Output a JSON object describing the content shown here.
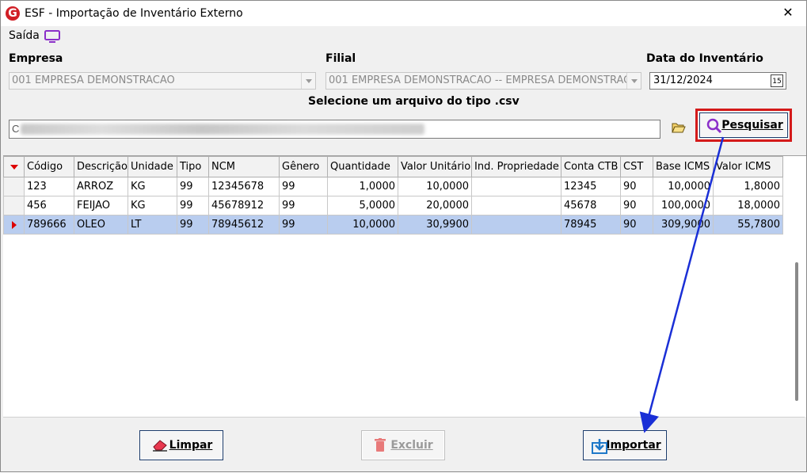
{
  "window": {
    "title": "ESF - Importação de Inventário Externo",
    "app_icon_letter": "G",
    "close_glyph": "✕"
  },
  "saida": {
    "label": "Saída",
    "icon": "monitor-icon"
  },
  "empresa": {
    "label": "Empresa",
    "value": "001 EMPRESA DEMONSTRACAO"
  },
  "filial": {
    "label": "Filial",
    "value": "001 EMPRESA DEMONSTRACAO -- EMPRESA DEMONSTRACAO"
  },
  "data_inventario": {
    "label": "Data do Inventário",
    "value": "31/12/2024",
    "calendar_icon_text": "15"
  },
  "arquivo": {
    "label": "Selecione um arquivo do tipo .csv",
    "value_prefix": "C"
  },
  "buttons": {
    "pesquisar": "Pesquisar",
    "limpar": "Limpar",
    "excluir": "Excluir",
    "importar": "Importar"
  },
  "table": {
    "columns": [
      "Código",
      "Descrição",
      "Unidade",
      "Tipo",
      "NCM",
      "Gênero",
      "Quantidade",
      "Valor Unitário",
      "Ind. Propriedade",
      "Conta CTB",
      "CST",
      "Base ICMS",
      "Valor ICMS"
    ],
    "rows": [
      [
        "123",
        "ARROZ",
        "KG",
        "99",
        "12345678",
        "99",
        "1,0000",
        "10,0000",
        "",
        "12345",
        "90",
        "10,0000",
        "1,8000"
      ],
      [
        "456",
        "FEIJAO",
        "KG",
        "99",
        "45678912",
        "99",
        "5,0000",
        "20,0000",
        "",
        "45678",
        "90",
        "100,0000",
        "18,0000"
      ],
      [
        "789666",
        "OLEO",
        "LT",
        "99",
        "78945612",
        "99",
        "10,0000",
        "30,9900",
        "",
        "78945",
        "90",
        "309,9000",
        "55,7800"
      ]
    ],
    "selected_row": 2
  },
  "colors": {
    "highlight": "#d41a1a",
    "arrow": "#1a2fd6",
    "selected_row": "#b9cdef",
    "accent_purple": "#8b2fc9"
  }
}
